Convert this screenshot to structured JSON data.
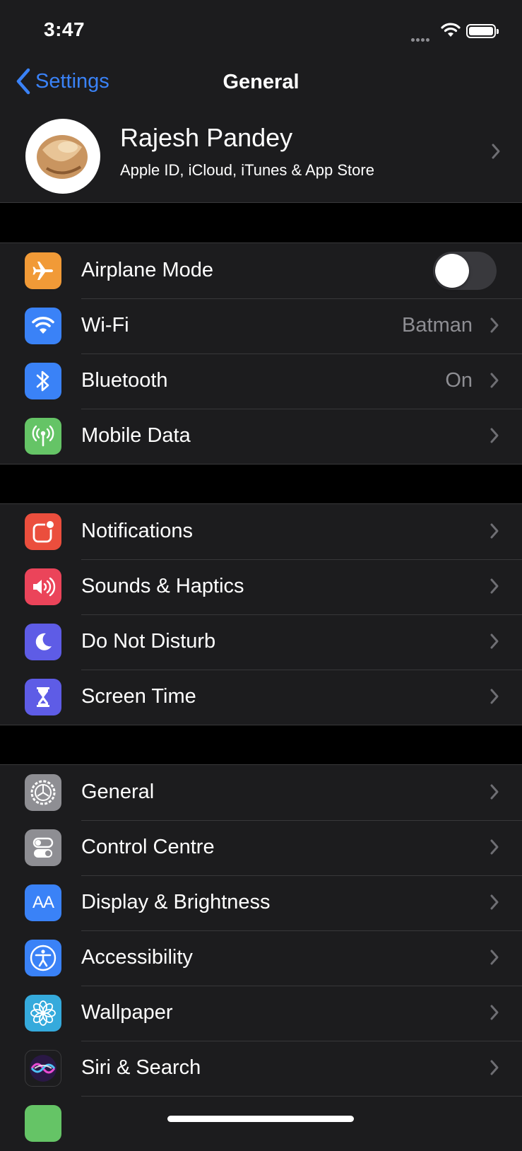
{
  "status": {
    "time": "3:47"
  },
  "nav": {
    "back_label": "Settings",
    "title": "General"
  },
  "profile": {
    "name": "Rajesh Pandey",
    "subtitle": "Apple ID, iCloud, iTunes & App Store"
  },
  "group1": {
    "airplane": {
      "label": "Airplane Mode",
      "icon": "airplane-icon",
      "color": "#f19a37",
      "toggle_on": false
    },
    "wifi": {
      "label": "Wi-Fi",
      "value": "Batman",
      "icon": "wifi-icon",
      "color": "#3a82f7"
    },
    "bluetooth": {
      "label": "Bluetooth",
      "value": "On",
      "icon": "bluetooth-icon",
      "color": "#3a82f7"
    },
    "mobile": {
      "label": "Mobile Data",
      "icon": "antenna-icon",
      "color": "#65c466"
    }
  },
  "group2": {
    "notifications": {
      "label": "Notifications",
      "icon": "notifications-icon",
      "color": "#eb4e3d"
    },
    "sounds": {
      "label": "Sounds & Haptics",
      "icon": "speaker-icon",
      "color": "#eb445a"
    },
    "dnd": {
      "label": "Do Not Disturb",
      "icon": "moon-icon",
      "color": "#5e5ce6"
    },
    "screentime": {
      "label": "Screen Time",
      "icon": "hourglass-icon",
      "color": "#5e5ce6"
    }
  },
  "group3": {
    "general": {
      "label": "General",
      "icon": "gear-icon",
      "color": "#8e8e93"
    },
    "control": {
      "label": "Control Centre",
      "icon": "switches-icon",
      "color": "#8e8e93"
    },
    "display": {
      "label": "Display & Brightness",
      "icon": "text-size-icon",
      "icon_text": "AA",
      "color": "#3a82f7"
    },
    "accessibility": {
      "label": "Accessibility",
      "icon": "accessibility-icon",
      "color": "#3a82f7"
    },
    "wallpaper": {
      "label": "Wallpaper",
      "icon": "flower-icon",
      "color": "#35aadc"
    },
    "siri": {
      "label": "Siri & Search",
      "icon": "siri-icon",
      "color": "#1c1c1e"
    }
  }
}
